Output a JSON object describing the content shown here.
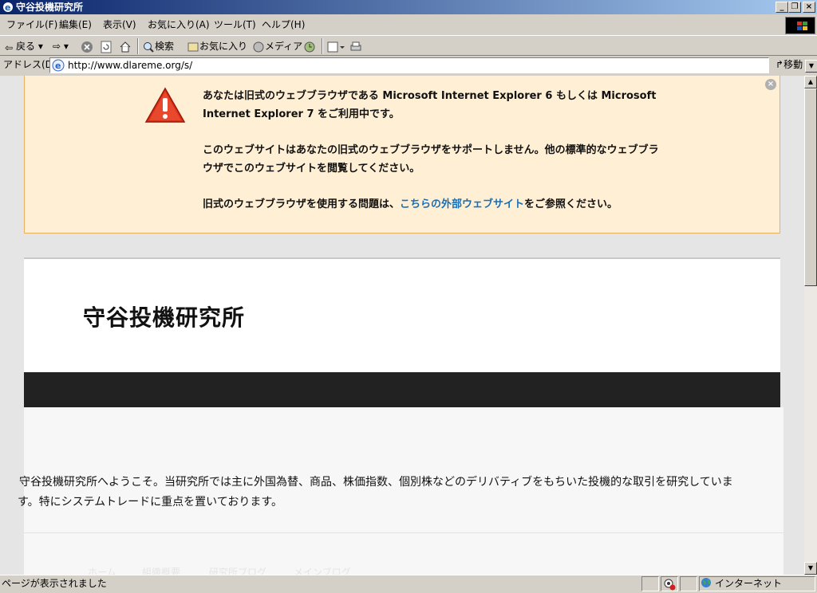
{
  "window": {
    "title": "守谷投機研究所"
  },
  "menu": [
    "ファイル(F)",
    "編集(E)",
    "表示(V)",
    "お気に入り(A)",
    "ツール(T)",
    "ヘルプ(H)"
  ],
  "toolbar": {
    "back": "戻る",
    "search": "検索",
    "favorites": "お気に入り",
    "media": "メディア"
  },
  "address": {
    "label": "アドレス(D)",
    "url": "http://www.dlareme.org/s/",
    "go": "移動"
  },
  "warning": {
    "line1": "あなたは旧式のウェブブラウザである Microsoft Internet Explorer 6 もしくは Microsoft Internet Explorer 7 をご利用中です。",
    "line2": "このウェブサイトはあなたの旧式のウェブブラウザをサポートしません。他の標準的なウェブブラウザでこのウェブサイトを閲覧してください。",
    "line3_pre": "旧式のウェブブラウザを使用する問題は、",
    "line3_link": "こちらの外部ウェブサイト",
    "line3_post": "をご参照ください。"
  },
  "site": {
    "title": "守谷投機研究所",
    "intro_line1": "守谷投機研究所へようこそ。当研究所では主に外国為替、商品、株価指数、個別株などのデリバティブをもちいた投機的な取引を研究していま",
    "intro_line2": "す。特にシステムトレードに重点を置いております。",
    "footer_links": [
      "ホーム",
      "組織概要",
      "研究所ブログ",
      "メインブログ"
    ]
  },
  "status": {
    "text": "ページが表示されました",
    "zone": "インターネット"
  },
  "colors": {
    "warning_bg": "#ffefd5",
    "warning_border": "#e8b060",
    "link": "#1a6fb4",
    "nav_bar": "#222222"
  }
}
